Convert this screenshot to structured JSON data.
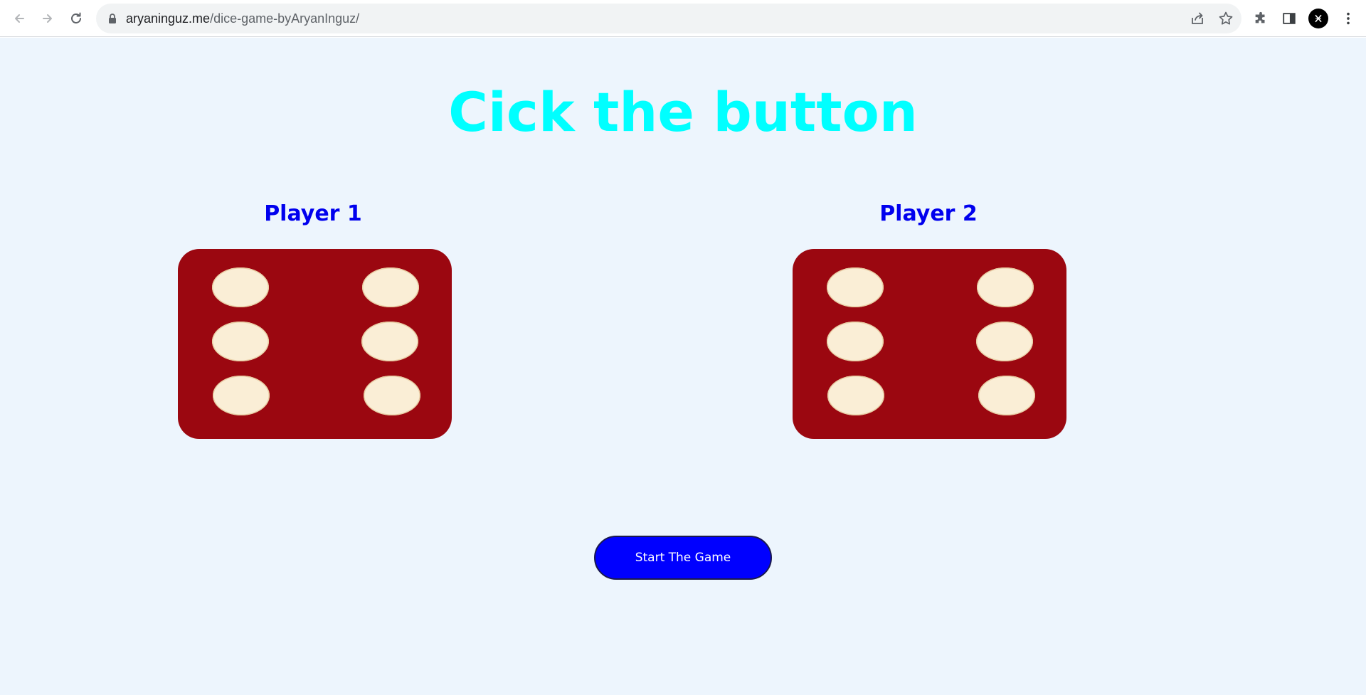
{
  "browser": {
    "url_host": "aryaninguz.me",
    "url_path": "/dice-game-byAryanInguz/",
    "icons": {
      "back": "back-arrow-icon",
      "forward": "forward-arrow-icon",
      "reload": "reload-icon",
      "lock": "lock-icon",
      "share": "share-icon",
      "bookmark": "star-icon",
      "extensions": "puzzle-icon",
      "side_panel": "side-panel-icon",
      "profile": "profile-avatar",
      "menu": "kebab-menu-icon"
    }
  },
  "page": {
    "headline": "Cick the button",
    "players": [
      {
        "name": "Player 1",
        "die_value": 6
      },
      {
        "name": "Player 2",
        "die_value": 6
      }
    ],
    "start_button_label": "Start The Game"
  },
  "colors": {
    "background": "#edf5fd",
    "headline": "#00ffff",
    "player_name": "#0000ee",
    "die_face": "#9b0710",
    "pip": "#faeed6",
    "button": "#0000ff"
  }
}
